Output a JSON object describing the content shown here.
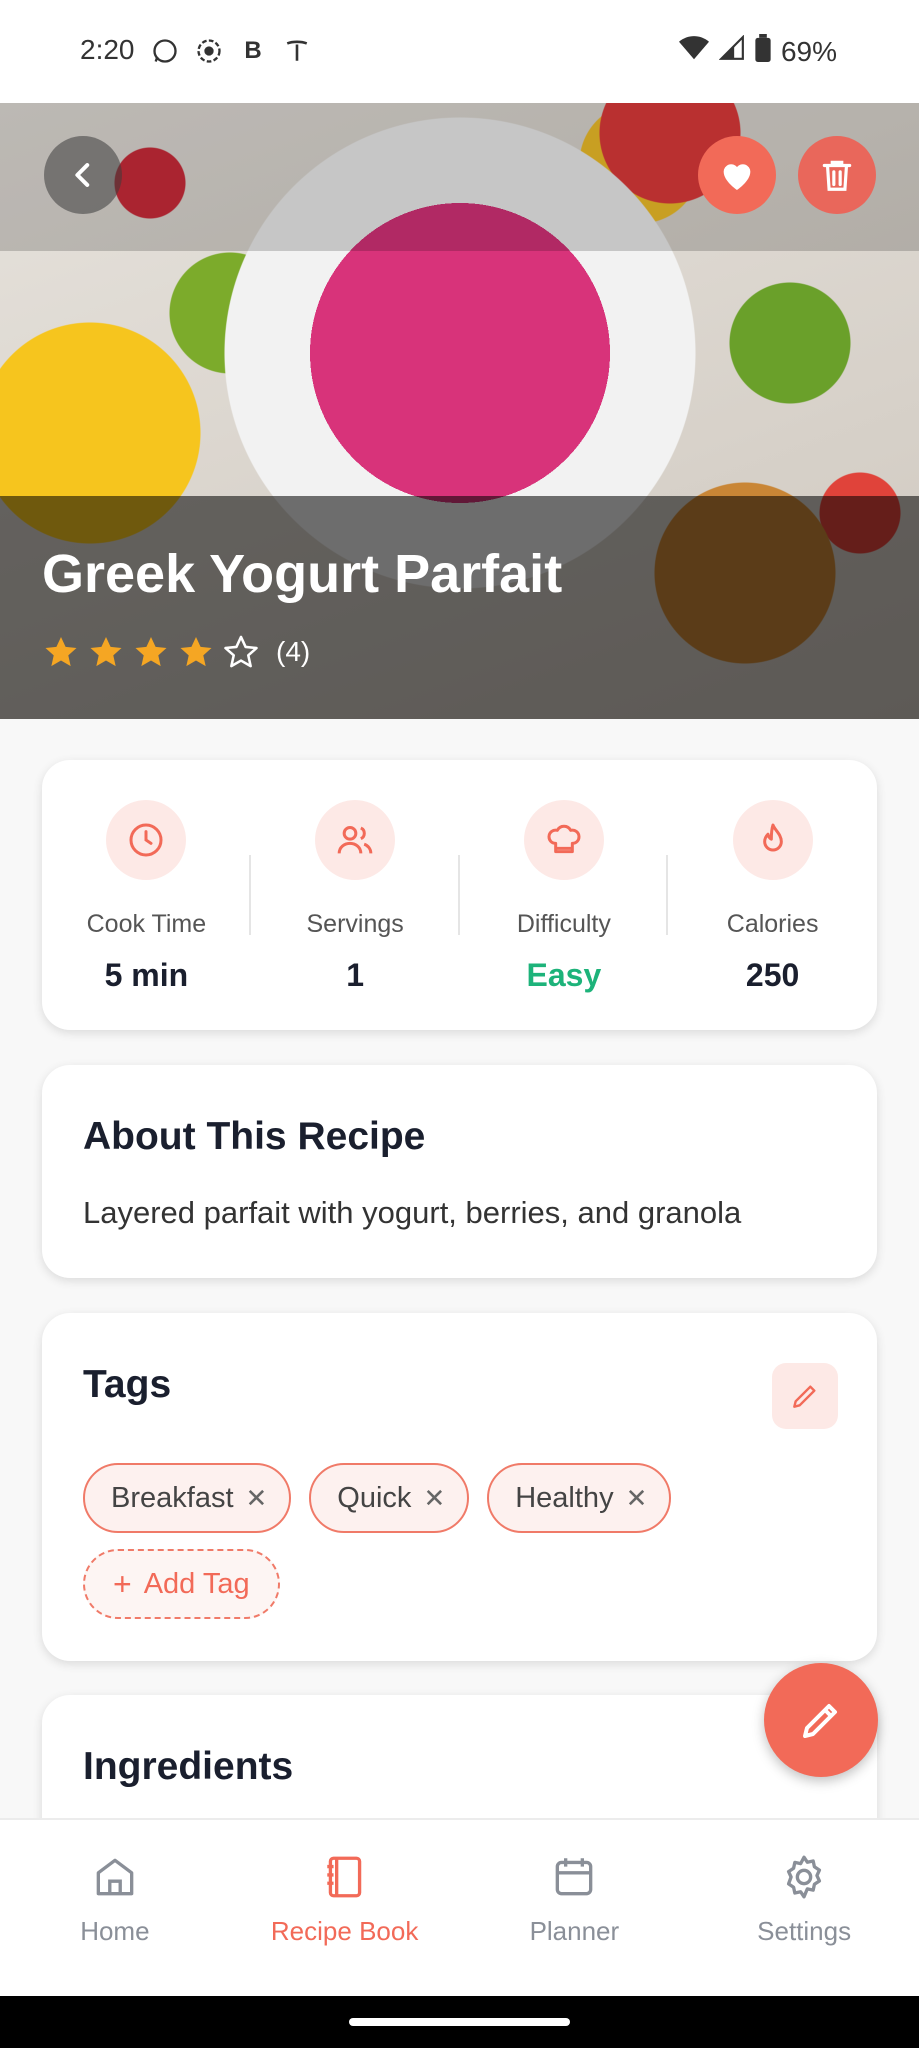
{
  "status_bar": {
    "time": "2:20",
    "battery": "69%"
  },
  "recipe": {
    "title": "Greek Yogurt Parfait",
    "rating": 4,
    "rating_max": 5,
    "rating_count": "(4)",
    "stats": [
      {
        "icon": "clock-icon",
        "label": "Cook Time",
        "value": "5 min"
      },
      {
        "icon": "users-icon",
        "label": "Servings",
        "value": "1"
      },
      {
        "icon": "chef-hat-icon",
        "label": "Difficulty",
        "value": "Easy"
      },
      {
        "icon": "flame-icon",
        "label": "Calories",
        "value": "250"
      }
    ],
    "about_title": "About This Recipe",
    "about_text": "Layered parfait with yogurt, berries, and granola",
    "tags_title": "Tags",
    "tags": [
      "Breakfast",
      "Quick",
      "Healthy"
    ],
    "add_tag_label": "Add Tag",
    "ingredients_title": "Ingredients"
  },
  "nav": {
    "items": [
      {
        "icon": "home-icon",
        "label": "Home",
        "active": false
      },
      {
        "icon": "recipe-book-icon",
        "label": "Recipe Book",
        "active": true
      },
      {
        "icon": "calendar-icon",
        "label": "Planner",
        "active": false
      },
      {
        "icon": "gear-icon",
        "label": "Settings",
        "active": false
      }
    ]
  },
  "colors": {
    "accent": "#f26a58",
    "accent_light": "#fde9e6",
    "success": "#1db37a",
    "star": "#f5a623"
  }
}
